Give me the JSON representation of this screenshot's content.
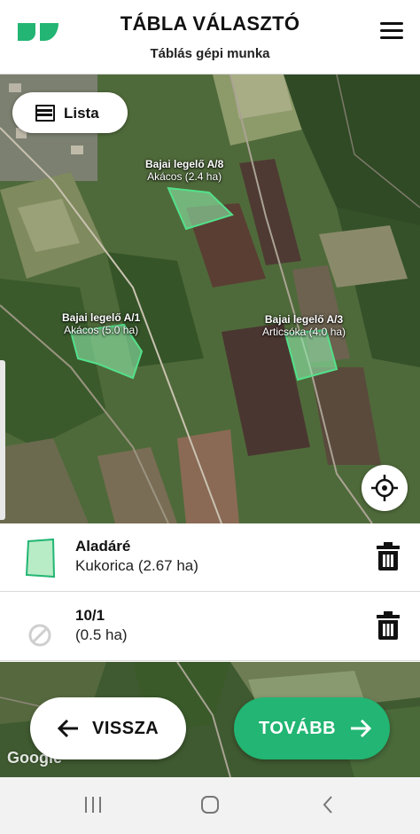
{
  "header": {
    "title": "TÁBLA VÁLASZTÓ",
    "subtitle": "Táblás gépi munka",
    "brand_color": "#22b573"
  },
  "map": {
    "list_button_label": "Lista",
    "attribution": "Google",
    "fields": [
      {
        "name": "Bajai legelő A/8",
        "crop": "Akácos (2.4 ha)"
      },
      {
        "name": "Bajai legelő A/1",
        "crop": "Akácos (5.0 ha)"
      },
      {
        "name": "Bajai legelő A/3",
        "crop": "Articsóka (4.0 ha)"
      }
    ]
  },
  "selected": [
    {
      "name": "Aladáré",
      "detail": "Kukorica (2.67 ha)",
      "icon": "field-shape-icon"
    },
    {
      "name": "10/1",
      "detail": "(0.5 ha)",
      "icon": "no-shape-icon"
    }
  ],
  "actions": {
    "back_label": "VISSZA",
    "next_label": "TOVÁBB"
  },
  "colors": {
    "accent": "#22b573",
    "field_fill": "#8ee8a8"
  }
}
